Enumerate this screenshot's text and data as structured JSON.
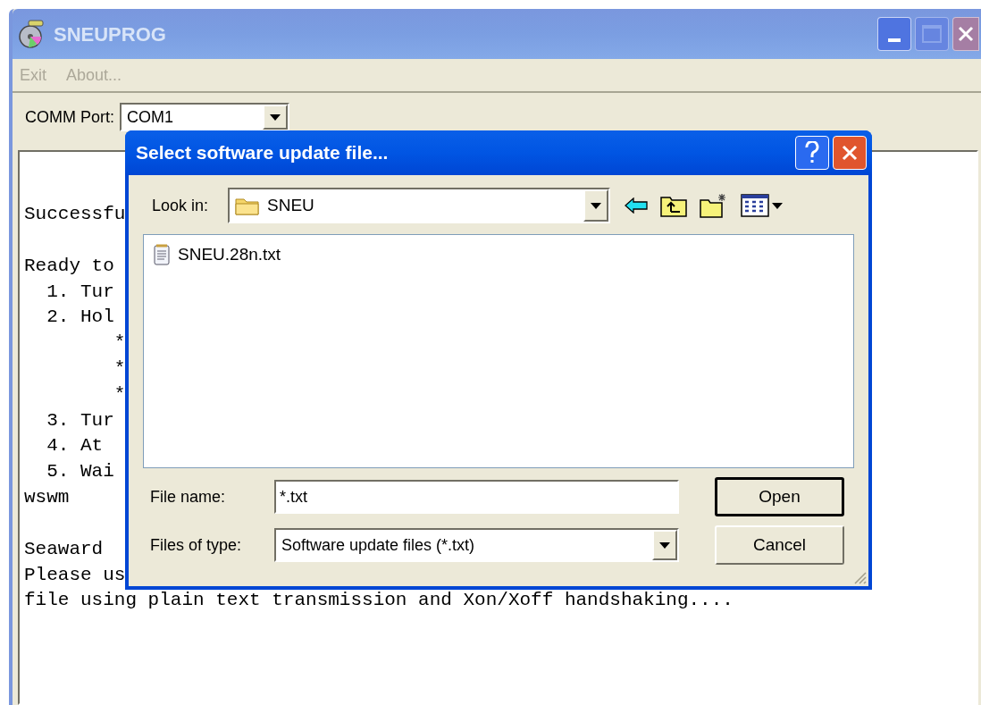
{
  "main_window": {
    "title": "SNEUPROG",
    "active": false,
    "menu": [
      {
        "label": "Exit",
        "disabled": true
      },
      {
        "label": "About...",
        "disabled": true
      }
    ],
    "comm_port": {
      "label": "COMM Port:",
      "value": "COM1"
    },
    "console": {
      "paragraphs": [
        [
          "Successfu"
        ],
        [
          "Ready to",
          "  1. Tur",
          "  2. Hol",
          "        *",
          "        *",
          "        *",
          "  3. Tur",
          "  4. At",
          "  5. Wai",
          "wswm"
        ],
        [
          "Seaward",
          "Please us",
          "file using plain text transmission and Xon/Xoff handshaking...."
        ]
      ]
    }
  },
  "dialog": {
    "title": "Select software update file...",
    "active": true,
    "look_in": {
      "label": "Look in:",
      "value": "SNEU"
    },
    "files": [
      {
        "name": "SNEU.28n.txt",
        "selected": false
      }
    ],
    "file_name": {
      "label": "File name:",
      "value": "*.txt"
    },
    "file_type": {
      "label": "Files of type:",
      "value": "Software update files (*.txt)"
    },
    "buttons": [
      {
        "label": "Open",
        "default": true
      },
      {
        "label": "Cancel",
        "default": false
      }
    ]
  }
}
